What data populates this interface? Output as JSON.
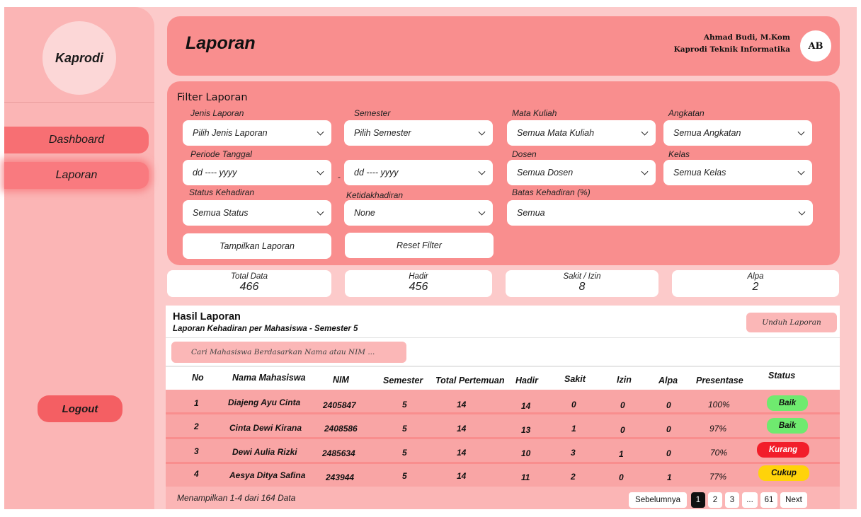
{
  "sidebar": {
    "logo": "Kaprodi",
    "items": [
      {
        "label": "Dashboard"
      },
      {
        "label": "Laporan"
      }
    ],
    "logout": "Logout"
  },
  "header": {
    "title": "Laporan",
    "user_name": "Ahmad Budi, M.Kom",
    "user_role": "Kaprodi Teknik Informatika",
    "avatar": "AB"
  },
  "filter": {
    "title": "Filter Laporan",
    "jenis_label": "Jenis Laporan",
    "jenis_value": "Pilih Jenis Laporan",
    "semester_label": "Semester",
    "semester_value": "Pilih Semester",
    "matkul_label": "Mata Kuliah",
    "matkul_value": "Semua Mata Kuliah",
    "angkatan_label": "Angkatan",
    "angkatan_value": "Semua Angkatan",
    "periode_label": "Periode Tanggal",
    "periode_from": "dd ---- yyyy",
    "periode_sep": "-",
    "periode_to": "dd ---- yyyy",
    "dosen_label": "Dosen",
    "dosen_value": "Semua Dosen",
    "kelas_label": "Kelas",
    "kelas_value": "Semua Kelas",
    "status_label": "Status Kehadiran",
    "status_value": "Semua Status",
    "ketidak_label": "Ketidakhadiran",
    "ketidak_value": "None",
    "batas_label": "Batas Kehadiran (%)",
    "batas_value": "Semua",
    "show_button": "Tampilkan Laporan",
    "reset_button": "Reset Filter"
  },
  "stats": {
    "total_label": "Total Data",
    "total_value": "466",
    "hadir_label": "Hadir",
    "hadir_value": "456",
    "sakit_label": "Sakit / Izin",
    "sakit_value": "8",
    "alpa_label": "Alpa",
    "alpa_value": "2"
  },
  "results": {
    "title": "Hasil Laporan",
    "subtitle": "Laporan Kehadiran per Mahasiswa - Semester 5",
    "download": "Unduh Laporan",
    "search_placeholder": "Cari Mahasiswa Berdasarkan Nama atau NIM ...",
    "columns": [
      "No",
      "Nama Mahasiswa",
      "NIM",
      "Semester",
      "Total Pertemuan",
      "Hadir",
      "Sakit",
      "Izin",
      "Alpa",
      "Presentase",
      "Status"
    ],
    "rows": [
      {
        "no": "1",
        "nama": "Diajeng Ayu Cinta",
        "nim": "2405847",
        "semester": "5",
        "total": "14",
        "hadir": "14",
        "sakit": "0",
        "izin": "0",
        "alpa": "0",
        "presentase": "100%",
        "status": "Baik"
      },
      {
        "no": "2",
        "nama": "Cinta Dewi Kirana",
        "nim": "2408586",
        "semester": "5",
        "total": "14",
        "hadir": "13",
        "sakit": "1",
        "izin": "0",
        "alpa": "0",
        "presentase": "97%",
        "status": "Baik"
      },
      {
        "no": "3",
        "nama": "Dewi Aulia Rizki",
        "nim": "2485634",
        "semester": "5",
        "total": "14",
        "hadir": "10",
        "sakit": "3",
        "izin": "1",
        "alpa": "0",
        "presentase": "70%",
        "status": "Kurang"
      },
      {
        "no": "4",
        "nama": "Aesya Ditya Safina",
        "nim": "243944",
        "semester": "5",
        "total": "14",
        "hadir": "11",
        "sakit": "2",
        "izin": "0",
        "alpa": "1",
        "presentase": "77%",
        "status": "Cukup"
      }
    ],
    "footer": "Menampilkan 1-4 dari 164 Data",
    "pager": {
      "prev": "Sebelumnya",
      "p1": "1",
      "p2": "2",
      "p3": "3",
      "ellipsis": "...",
      "last": "61",
      "next": "Next"
    }
  },
  "colors": {
    "page_bg": "#fccaca",
    "sidebar_bg": "#fbb5b5",
    "panel_bg": "#f98e8e",
    "nav_active": "#f76f73",
    "status_baik": "#6fea6f",
    "status_kurang": "#f21e2a",
    "status_cukup": "#ffd30a"
  }
}
